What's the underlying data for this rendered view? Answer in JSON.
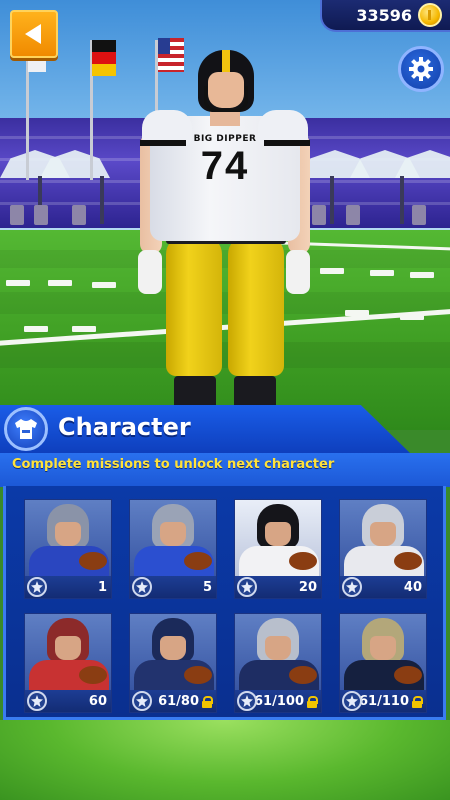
{
  "hud": {
    "coins": "33596",
    "back_icon": "back-arrow-icon",
    "settings_icon": "gear-icon",
    "coin_icon": "coin-icon"
  },
  "player": {
    "jersey_brand": "BIG DIPPER",
    "jersey_number": "74"
  },
  "panel": {
    "title": "Character",
    "subtitle": "Complete missions to unlock next character",
    "icon": "shirt-icon"
  },
  "characters": [
    {
      "label": "1",
      "locked": false,
      "helmet": "#8a93a8",
      "jersey": "#2a46c0",
      "selected": false
    },
    {
      "label": "5",
      "locked": false,
      "helmet": "#9aa3b6",
      "jersey": "#2b4fd0",
      "selected": false
    },
    {
      "label": "20",
      "locked": false,
      "helmet": "#15151a",
      "jersey": "#f2f2f4",
      "selected": true
    },
    {
      "label": "40",
      "locked": false,
      "helmet": "#c9ced8",
      "jersey": "#e8e9ee",
      "selected": false
    },
    {
      "label": "60",
      "locked": false,
      "helmet": "#8c2a2a",
      "jersey": "#c83232",
      "selected": false
    },
    {
      "label": "61/80",
      "locked": true,
      "helmet": "#1b2a5a",
      "jersey": "#22336e",
      "selected": false
    },
    {
      "label": "61/100",
      "locked": true,
      "helmet": "#b8bfcc",
      "jersey": "#1e2d63",
      "selected": false
    },
    {
      "label": "61/110",
      "locked": true,
      "helmet": "#b3a77a",
      "jersey": "#15203f",
      "selected": false
    }
  ],
  "colors": {
    "accent_orange": "#f08a00",
    "panel_blue": "#0b3aa8",
    "subtitle_yellow": "#ffe23a",
    "lock_gold": "#f2c400"
  }
}
